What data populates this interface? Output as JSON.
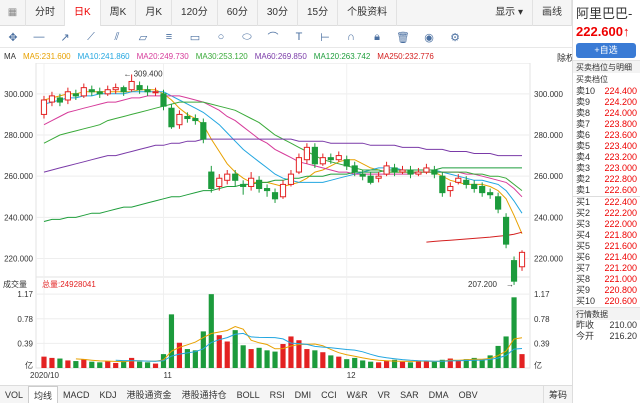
{
  "tabs": [
    {
      "label": "分时",
      "active": false
    },
    {
      "label": "日K",
      "active": true
    },
    {
      "label": "周K",
      "active": false
    },
    {
      "label": "月K",
      "active": false
    },
    {
      "label": "120分",
      "active": false
    },
    {
      "label": "60分",
      "active": false
    },
    {
      "label": "30分",
      "active": false
    },
    {
      "label": "15分",
      "active": false
    }
  ],
  "tab_more": "个股资料",
  "tab_display": "显示",
  "tab_draw": "画线",
  "toolbar_icons": [
    "move-icon",
    "line-icon",
    "ray-icon",
    "trend-line-icon",
    "parallel-icon",
    "channel-icon",
    "fib-icon",
    "rect-icon",
    "circle-icon",
    "ellipse-icon",
    "arc-icon",
    "text-icon",
    "measure-icon",
    "magnet-icon",
    "lock-icon",
    "delete-icon",
    "hide-icon",
    "settings-icon"
  ],
  "ma_legend": [
    {
      "label": "MA",
      "color": "#333333"
    },
    {
      "label": "MA5:231.600",
      "color": "#e8a100"
    },
    {
      "label": "MA10:241.860",
      "color": "#22a6e0"
    },
    {
      "label": "MA20:249.730",
      "color": "#d63b9a"
    },
    {
      "label": "MA30:253.120",
      "color": "#3aaa3a"
    },
    {
      "label": "MA60:269.850",
      "color": "#7a3aa8"
    },
    {
      "label": "MA120:263.742",
      "color": "#1f9e3c"
    },
    {
      "label": "MA250:232.776",
      "color": "#d42020"
    }
  ],
  "rights": "除权",
  "vol_legend": {
    "label": "成交量",
    "total": "总量:24928041"
  },
  "quote": {
    "name": "阿里巴巴-",
    "price": "222.600",
    "arrow": "↑",
    "add_button": "+自选",
    "section_title": "买卖档位与明细",
    "order_title": "买卖档位",
    "asks": [
      {
        "label": "卖10",
        "value": "224.400"
      },
      {
        "label": "卖9",
        "value": "224.200"
      },
      {
        "label": "卖8",
        "value": "224.000"
      },
      {
        "label": "卖7",
        "value": "223.800"
      },
      {
        "label": "卖6",
        "value": "223.600"
      },
      {
        "label": "卖5",
        "value": "223.400"
      },
      {
        "label": "卖4",
        "value": "223.200"
      },
      {
        "label": "卖3",
        "value": "223.000"
      },
      {
        "label": "卖2",
        "value": "222.800"
      },
      {
        "label": "卖1",
        "value": "222.600"
      }
    ],
    "bids": [
      {
        "label": "买1",
        "value": "222.400",
        "tone": "red"
      },
      {
        "label": "买2",
        "value": "222.200",
        "tone": "red"
      },
      {
        "label": "买3",
        "value": "222.000",
        "tone": "red"
      },
      {
        "label": "买4",
        "value": "221.800",
        "tone": "red"
      },
      {
        "label": "买5",
        "value": "221.600",
        "tone": "red"
      },
      {
        "label": "买6",
        "value": "221.400",
        "tone": "red"
      },
      {
        "label": "买7",
        "value": "221.200",
        "tone": "red"
      },
      {
        "label": "买8",
        "value": "221.000",
        "tone": "red"
      },
      {
        "label": "买9",
        "value": "220.800",
        "tone": "red"
      },
      {
        "label": "买10",
        "value": "220.600",
        "tone": "red"
      }
    ],
    "detail_title": "行情数据",
    "details": [
      {
        "label": "昨收",
        "value": "210.00"
      },
      {
        "label": "今开",
        "value": "216.20"
      }
    ]
  },
  "bottom_tabs": [
    "VOL",
    "均线",
    "MACD",
    "KDJ",
    "港股通资金",
    "港股通持仓",
    "BOLL",
    "RSI",
    "DMI",
    "CCI",
    "W&R",
    "VR",
    "SAR",
    "DMA",
    "OBV"
  ],
  "bottom_active": "均线",
  "bottom_right": "筹码",
  "chart_data": {
    "type": "candlestick",
    "x_labels": [
      "2020/10",
      "11",
      "12"
    ],
    "price_axis": [
      300,
      280,
      260,
      240,
      220
    ],
    "price_axis_labels": [
      "300.000",
      "280.000",
      "260.000",
      "240.000",
      "220.000"
    ],
    "price_ylim": [
      212,
      314
    ],
    "high_annotation": "309.400",
    "low_annotation": "207.200",
    "volume_axis_labels": [
      "1.17",
      "0.78",
      "0.39",
      "亿"
    ],
    "volume_ylim": [
      0,
      1.22
    ],
    "candles": [
      {
        "o": 290,
        "c": 297,
        "h": 299,
        "l": 288
      },
      {
        "o": 296,
        "c": 299,
        "h": 301,
        "l": 294
      },
      {
        "o": 298,
        "c": 296,
        "h": 300,
        "l": 294
      },
      {
        "o": 297,
        "c": 301,
        "h": 303,
        "l": 295
      },
      {
        "o": 300,
        "c": 299,
        "h": 302,
        "l": 297
      },
      {
        "o": 299,
        "c": 303,
        "h": 305,
        "l": 298
      },
      {
        "o": 302,
        "c": 301,
        "h": 304,
        "l": 299
      },
      {
        "o": 301,
        "c": 300,
        "h": 303,
        "l": 298
      },
      {
        "o": 300,
        "c": 302,
        "h": 304,
        "l": 299
      },
      {
        "o": 302,
        "c": 303,
        "h": 305,
        "l": 300
      },
      {
        "o": 303,
        "c": 301,
        "h": 304,
        "l": 299
      },
      {
        "o": 302,
        "c": 306,
        "h": 309.4,
        "l": 301
      },
      {
        "o": 304,
        "c": 302,
        "h": 306,
        "l": 300
      },
      {
        "o": 302,
        "c": 301,
        "h": 304,
        "l": 299
      },
      {
        "o": 301,
        "c": 301,
        "h": 303,
        "l": 299
      },
      {
        "o": 300,
        "c": 294,
        "h": 302,
        "l": 292
      },
      {
        "o": 293,
        "c": 284,
        "h": 295,
        "l": 283
      },
      {
        "o": 285,
        "c": 290,
        "h": 292,
        "l": 283
      },
      {
        "o": 289,
        "c": 288,
        "h": 291,
        "l": 286
      },
      {
        "o": 288,
        "c": 287,
        "h": 290,
        "l": 285
      },
      {
        "o": 286,
        "c": 278,
        "h": 288,
        "l": 276
      },
      {
        "o": 262,
        "c": 254,
        "h": 265,
        "l": 252
      },
      {
        "o": 255,
        "c": 259,
        "h": 261,
        "l": 253
      },
      {
        "o": 258,
        "c": 261,
        "h": 263,
        "l": 256
      },
      {
        "o": 261,
        "c": 258,
        "h": 263,
        "l": 255
      },
      {
        "o": 256,
        "c": 255,
        "h": 258,
        "l": 251
      },
      {
        "o": 255,
        "c": 259,
        "h": 262,
        "l": 253
      },
      {
        "o": 258,
        "c": 254,
        "h": 260,
        "l": 252
      },
      {
        "o": 254,
        "c": 253,
        "h": 256,
        "l": 250
      },
      {
        "o": 252,
        "c": 249,
        "h": 254,
        "l": 247
      },
      {
        "o": 250,
        "c": 256,
        "h": 258,
        "l": 249
      },
      {
        "o": 256,
        "c": 261,
        "h": 263,
        "l": 255
      },
      {
        "o": 262,
        "c": 269,
        "h": 271,
        "l": 261
      },
      {
        "o": 268,
        "c": 274,
        "h": 276,
        "l": 266
      },
      {
        "o": 274,
        "c": 266,
        "h": 276,
        "l": 264
      },
      {
        "o": 266,
        "c": 269,
        "h": 271,
        "l": 265
      },
      {
        "o": 269,
        "c": 268,
        "h": 271,
        "l": 266
      },
      {
        "o": 268,
        "c": 270,
        "h": 272,
        "l": 267
      },
      {
        "o": 268,
        "c": 265,
        "h": 270,
        "l": 263
      },
      {
        "o": 265,
        "c": 262,
        "h": 267,
        "l": 260
      },
      {
        "o": 261,
        "c": 260,
        "h": 263,
        "l": 258
      },
      {
        "o": 260,
        "c": 257,
        "h": 262,
        "l": 256
      },
      {
        "o": 259,
        "c": 260,
        "h": 262,
        "l": 257
      },
      {
        "o": 261,
        "c": 265,
        "h": 267,
        "l": 260
      },
      {
        "o": 264,
        "c": 262,
        "h": 266,
        "l": 260
      },
      {
        "o": 262,
        "c": 263,
        "h": 265,
        "l": 261
      },
      {
        "o": 263,
        "c": 261,
        "h": 265,
        "l": 259
      },
      {
        "o": 261,
        "c": 262,
        "h": 264,
        "l": 260
      },
      {
        "o": 262,
        "c": 264,
        "h": 266,
        "l": 261
      },
      {
        "o": 263,
        "c": 261,
        "h": 265,
        "l": 259
      },
      {
        "o": 260,
        "c": 252,
        "h": 262,
        "l": 250
      },
      {
        "o": 253,
        "c": 255,
        "h": 257,
        "l": 250
      },
      {
        "o": 257,
        "c": 259,
        "h": 261,
        "l": 256
      },
      {
        "o": 258,
        "c": 256,
        "h": 260,
        "l": 254
      },
      {
        "o": 256,
        "c": 254,
        "h": 258,
        "l": 252
      },
      {
        "o": 255,
        "c": 252,
        "h": 257,
        "l": 250
      },
      {
        "o": 252,
        "c": 251,
        "h": 254,
        "l": 249
      },
      {
        "o": 250,
        "c": 244,
        "h": 252,
        "l": 242
      },
      {
        "o": 240,
        "c": 227,
        "h": 242,
        "l": 225
      },
      {
        "o": 219,
        "c": 209,
        "h": 221,
        "l": 207.2
      },
      {
        "o": 216,
        "c": 223,
        "h": 224,
        "l": 214
      }
    ],
    "volumes": [
      0.18,
      0.16,
      0.15,
      0.12,
      0.11,
      0.14,
      0.1,
      0.09,
      0.11,
      0.08,
      0.12,
      0.16,
      0.1,
      0.09,
      0.07,
      0.22,
      0.85,
      0.4,
      0.3,
      0.28,
      0.58,
      1.17,
      0.52,
      0.42,
      0.6,
      0.36,
      0.3,
      0.32,
      0.28,
      0.26,
      0.38,
      0.5,
      0.44,
      0.3,
      0.28,
      0.25,
      0.2,
      0.18,
      0.14,
      0.16,
      0.12,
      0.1,
      0.09,
      0.11,
      0.13,
      0.1,
      0.09,
      0.12,
      0.11,
      0.1,
      0.13,
      0.15,
      0.12,
      0.14,
      0.16,
      0.13,
      0.2,
      0.35,
      0.5,
      1.12,
      0.22
    ],
    "ma_series": {
      "MA5": [
        297,
        298,
        299,
        300,
        300,
        301,
        301,
        301,
        301,
        301,
        301,
        301,
        302,
        302,
        302,
        300,
        297,
        293,
        290,
        288,
        285,
        278,
        272,
        266,
        262,
        259,
        257,
        257,
        257,
        256,
        255,
        256,
        257,
        259,
        262,
        263,
        265,
        267,
        268,
        268,
        266,
        264,
        263,
        262,
        262,
        262,
        262,
        262,
        262,
        262,
        260,
        258,
        257,
        256,
        256,
        256,
        255,
        253,
        249,
        241,
        232
      ],
      "MA10": [
        295,
        296,
        297,
        298,
        298,
        299,
        299,
        300,
        300,
        300,
        300,
        301,
        301,
        301,
        301,
        301,
        299,
        297,
        295,
        293,
        291,
        288,
        285,
        281,
        277,
        273,
        270,
        267,
        264,
        261,
        259,
        258,
        257,
        257,
        257,
        257,
        258,
        259,
        260,
        261,
        262,
        263,
        264,
        264,
        264,
        263,
        263,
        263,
        263,
        263,
        262,
        261,
        260,
        259,
        258,
        258,
        257,
        256,
        253,
        248,
        242
      ],
      "MA20": [
        285,
        287,
        289,
        291,
        292,
        293,
        294,
        295,
        296,
        296,
        297,
        298,
        298,
        299,
        299,
        299,
        299,
        299,
        298,
        297,
        296,
        294,
        292,
        289,
        287,
        284,
        281,
        278,
        276,
        273,
        271,
        269,
        267,
        266,
        265,
        264,
        263,
        262,
        262,
        261,
        261,
        261,
        261,
        261,
        261,
        261,
        261,
        262,
        262,
        262,
        262,
        262,
        262,
        261,
        261,
        260,
        259,
        258,
        257,
        254,
        250
      ],
      "MA30": [
        276,
        278,
        280,
        281,
        282,
        283,
        284,
        285,
        287,
        288,
        289,
        290,
        291,
        292,
        293,
        294,
        295,
        296,
        296,
        296,
        296,
        295,
        294,
        293,
        292,
        290,
        288,
        286,
        283,
        280,
        278,
        276,
        274,
        272,
        270,
        268,
        267,
        266,
        265,
        264,
        263,
        263,
        263,
        262,
        262,
        262,
        262,
        262,
        262,
        262,
        262,
        262,
        262,
        262,
        261,
        261,
        260,
        260,
        259,
        256,
        253
      ],
      "MA60": [
        262,
        263,
        264,
        265,
        266,
        267,
        268,
        269,
        270,
        270,
        271,
        272,
        273,
        274,
        275,
        275,
        276,
        276,
        277,
        277,
        278,
        278,
        278,
        278,
        278,
        278,
        278,
        278,
        278,
        278,
        278,
        278,
        277,
        277,
        277,
        277,
        276,
        276,
        276,
        276,
        276,
        275,
        275,
        275,
        275,
        274,
        274,
        274,
        273,
        273,
        273,
        272,
        272,
        272,
        271,
        271,
        271,
        270,
        270,
        270,
        270
      ],
      "MA120": [
        238,
        239,
        239,
        240,
        240,
        241,
        242,
        242,
        243,
        244,
        245,
        245,
        246,
        247,
        248,
        249,
        250,
        250,
        251,
        252,
        253,
        253,
        254,
        255,
        255,
        256,
        256,
        257,
        257,
        258,
        258,
        259,
        259,
        260,
        260,
        260,
        261,
        261,
        261,
        262,
        262,
        262,
        262,
        263,
        263,
        263,
        263,
        263,
        263,
        263,
        264,
        264,
        264,
        264,
        264,
        264,
        264,
        264,
        264,
        264,
        264
      ],
      "MA250": [
        null,
        null,
        null,
        null,
        null,
        null,
        null,
        null,
        null,
        null,
        null,
        null,
        null,
        null,
        null,
        null,
        null,
        null,
        null,
        null,
        null,
        null,
        null,
        null,
        null,
        null,
        null,
        null,
        null,
        null,
        null,
        null,
        null,
        null,
        null,
        null,
        null,
        null,
        null,
        null,
        null,
        null,
        null,
        null,
        null,
        null,
        null,
        null,
        228.0,
        228.3,
        228.6,
        228.9,
        229.2,
        229.5,
        229.8,
        230.1,
        230.4,
        230.8,
        231.2,
        231.8,
        232.8
      ]
    }
  }
}
